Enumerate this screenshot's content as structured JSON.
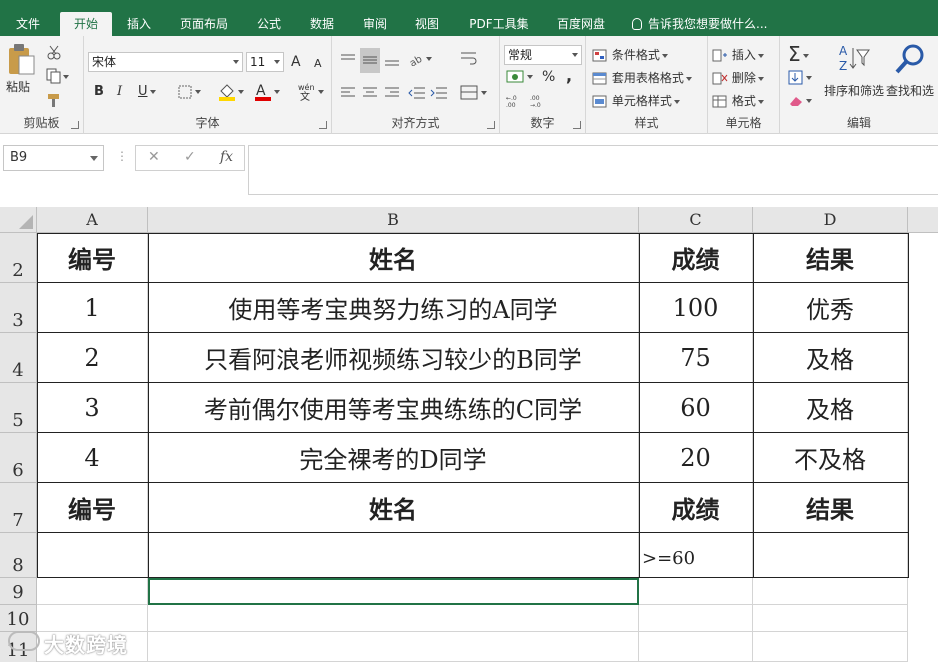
{
  "tabs": [
    "文件",
    "开始",
    "插入",
    "页面布局",
    "公式",
    "数据",
    "审阅",
    "视图",
    "PDF工具集",
    "百度网盘"
  ],
  "tell_me": "告诉我您想要做什么...",
  "ribbon": {
    "clipboard": {
      "paste": "粘贴",
      "label": "剪贴板"
    },
    "font": {
      "name": "宋体",
      "size": "11",
      "bold": "B",
      "italic": "I",
      "underline": "U",
      "label": "字体",
      "grow": "A",
      "shrink": "A"
    },
    "alignment": {
      "label": "对齐方式"
    },
    "number": {
      "format": "常规",
      "percent": "%",
      "comma": ",",
      "label": "数字"
    },
    "styles": {
      "conditional": "条件格式",
      "table": "套用表格格式",
      "cell": "单元格样式",
      "label": "样式"
    },
    "cells": {
      "insert": "插入",
      "delete": "删除",
      "format": "格式",
      "label": "单元格"
    },
    "editing": {
      "sort": "排序和筛选",
      "find": "查找和选",
      "sum": "Σ",
      "label": "编辑"
    }
  },
  "formula_bar": {
    "name_box": "B9",
    "cancel": "✕",
    "confirm": "✓",
    "fx": "fx",
    "content": ""
  },
  "columns": [
    "A",
    "B",
    "C",
    "D"
  ],
  "rows": [
    {
      "num": "2",
      "cells": [
        "编号",
        "姓名",
        "成绩",
        "结果"
      ],
      "header": true
    },
    {
      "num": "3",
      "cells": [
        "1",
        "使用等考宝典努力练习的A同学",
        "100",
        "优秀"
      ]
    },
    {
      "num": "4",
      "cells": [
        "2",
        "只看阿浪老师视频练习较少的B同学",
        "75",
        "及格"
      ]
    },
    {
      "num": "5",
      "cells": [
        "3",
        "考前偶尔使用等考宝典练练的C同学",
        "60",
        "及格"
      ]
    },
    {
      "num": "6",
      "cells": [
        "4",
        "完全裸考的D同学",
        "20",
        "不及格"
      ]
    },
    {
      "num": "7",
      "cells": [
        "编号",
        "姓名",
        "成绩",
        "结果"
      ],
      "header": true
    },
    {
      "num": "8",
      "cells": [
        "",
        "",
        ">=60",
        ""
      ]
    },
    {
      "num": "9",
      "cells": [
        "",
        "",
        "",
        ""
      ]
    },
    {
      "num": "10",
      "cells": [
        "",
        "",
        "",
        ""
      ]
    },
    {
      "num": "11",
      "cells": [
        "",
        "",
        "",
        ""
      ]
    }
  ],
  "watermark": "大数跨境"
}
